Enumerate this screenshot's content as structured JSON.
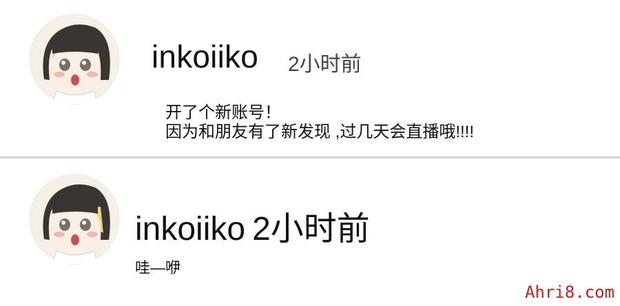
{
  "posts": [
    {
      "username": "inkoiiko",
      "time": "2小时前",
      "lines": [
        "开了个新账号！",
        "因为和朋友有了新发现 ,过几天会直播哦!!!!"
      ]
    },
    {
      "username": "inkoiiko",
      "time": "2小时前",
      "lines": [
        "哇—咿"
      ]
    }
  ],
  "watermark": "Ahri8.com",
  "colors": {
    "divider": "#d6d6d6",
    "watermark": "#d11a1a",
    "hair": "#3b3531",
    "highlight": "#e6d87a"
  }
}
